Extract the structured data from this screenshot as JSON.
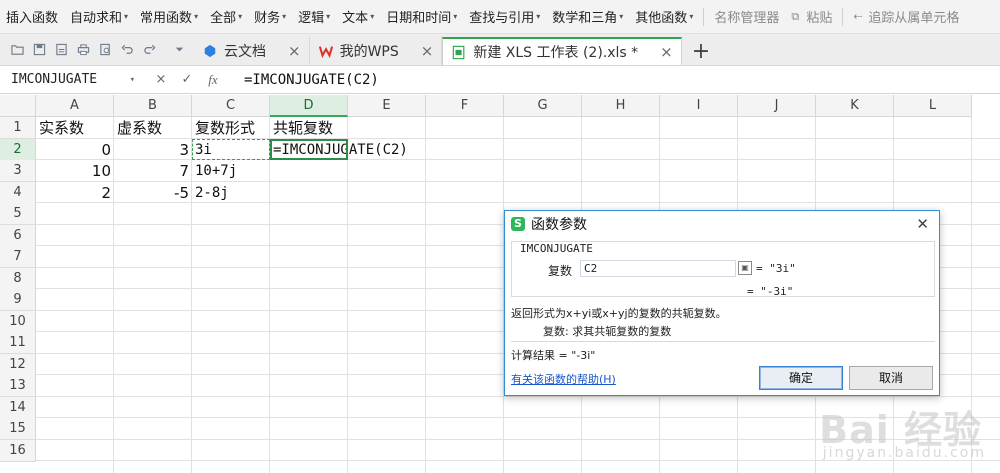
{
  "ribbon": {
    "items": [
      {
        "label": "插入函数",
        "dropdown": false
      },
      {
        "label": "自动求和",
        "dropdown": true
      },
      {
        "label": "常用函数",
        "dropdown": true
      },
      {
        "label": "全部",
        "dropdown": true
      },
      {
        "label": "财务",
        "dropdown": true
      },
      {
        "label": "逻辑",
        "dropdown": true
      },
      {
        "label": "文本",
        "dropdown": true
      },
      {
        "label": "日期和时间",
        "dropdown": true
      },
      {
        "label": "查找与引用",
        "dropdown": true
      },
      {
        "label": "数学和三角",
        "dropdown": true
      },
      {
        "label": "其他函数",
        "dropdown": true
      }
    ],
    "name_manager": "名称管理器",
    "paste": "粘贴",
    "trace_precedents": "追踪从属单元格"
  },
  "tabs": {
    "items": [
      {
        "label": "云文档",
        "icon": "cloud-icon"
      },
      {
        "label": "我的WPS",
        "icon": "wps-logo-icon"
      },
      {
        "label": "新建 XLS 工作表 (2).xls *",
        "icon": "spreadsheet-icon"
      }
    ],
    "active_index": 2
  },
  "formula_bar": {
    "name_box": "IMCONJUGATE",
    "cancel": "×",
    "confirm": "✓",
    "fx": "fx",
    "formula": "=IMCONJUGATE(C2)"
  },
  "sheet": {
    "columns": [
      "A",
      "B",
      "C",
      "D",
      "E",
      "F",
      "G",
      "H",
      "I",
      "J",
      "K",
      "L"
    ],
    "rows": [
      "1",
      "2",
      "3",
      "4",
      "5",
      "6",
      "7",
      "8",
      "9",
      "10",
      "11",
      "12",
      "13",
      "14",
      "15",
      "16"
    ],
    "cells": {
      "A1": "实系数",
      "B1": "虚系数",
      "C1": "复数形式",
      "D1": "共轭复数",
      "A2": "0",
      "B2": "3",
      "C2": "3i",
      "D2": "=IMCONJUGATE(C2)",
      "A3": "10",
      "B3": "7",
      "C3": "10+7j",
      "A4": "2",
      "B4": "-5",
      "C4": "2-8j"
    },
    "active_cell": "D2"
  },
  "dialog": {
    "title": "函数参数",
    "function_name": "IMCONJUGATE",
    "arg_label": "复数",
    "arg_value": "C2",
    "arg_result": "= \"3i\"",
    "overall_result": "= \"-3i\"",
    "description": "返回形式为x+yi或x+yj的复数的共轭复数。",
    "arg_description": "复数: 求其共轭复数的复数",
    "calc_result": "计算结果 = \"-3i\"",
    "help_link": "有关该函数的帮助(H)",
    "ok": "确定",
    "cancel": "取消"
  },
  "watermark": {
    "main": "Bai 经验",
    "sub": "jingyan.baidu.com"
  }
}
